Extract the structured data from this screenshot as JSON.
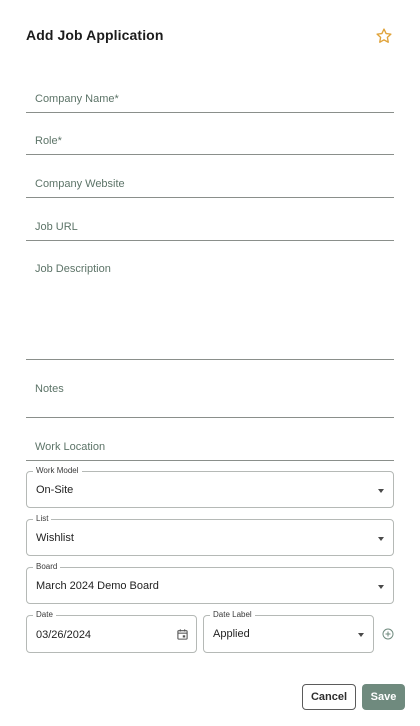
{
  "dialog": {
    "title": "Add Job Application"
  },
  "fields": {
    "company_name": {
      "label": "Company Name",
      "required_mark": "*"
    },
    "role": {
      "label": "Role",
      "required_mark": "*"
    },
    "company_website": {
      "label": "Company Website"
    },
    "job_url": {
      "label": "Job URL"
    },
    "job_description": {
      "label": "Job Description"
    },
    "notes": {
      "label": "Notes"
    },
    "work_location": {
      "label": "Work Location"
    },
    "work_model": {
      "label": "Work Model",
      "value": "On-Site"
    },
    "list": {
      "label": "List",
      "value": "Wishlist"
    },
    "board": {
      "label": "Board",
      "value": "March 2024 Demo Board"
    },
    "date": {
      "label": "Date",
      "value": "03/26/2024"
    },
    "date_label": {
      "label": "Date Label",
      "value": "Applied"
    }
  },
  "actions": {
    "cancel_label": "Cancel",
    "save_label": "Save"
  },
  "icons": {
    "favorite": "star-outline-icon",
    "calendar": "calendar-icon",
    "add_date": "add-circle-icon"
  },
  "colors": {
    "accent_green": "#6f8a7e",
    "label_green": "#5d7468",
    "star_orange": "#e0a33a"
  }
}
